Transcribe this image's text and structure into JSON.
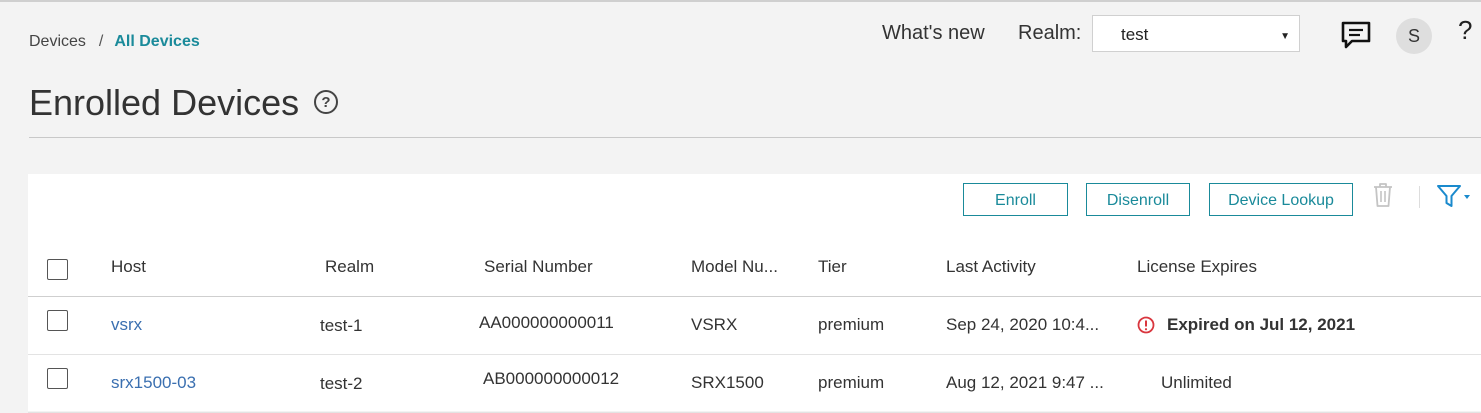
{
  "breadcrumb": {
    "parent": "Devices",
    "separator": "/",
    "current": "All Devices"
  },
  "header": {
    "whats_new": "What's new",
    "realm_label": "Realm:",
    "realm_value": "test",
    "avatar_initial": "S",
    "help": "?"
  },
  "page": {
    "title": "Enrolled Devices",
    "help_glyph": "?"
  },
  "toolbar": {
    "enroll": "Enroll",
    "disenroll": "Disenroll",
    "device_lookup": "Device Lookup"
  },
  "table": {
    "columns": {
      "host": "Host",
      "realm": "Realm",
      "serial": "Serial Number",
      "model": "Model Nu...",
      "tier": "Tier",
      "last_activity": "Last Activity",
      "license": "License Expires"
    },
    "rows": [
      {
        "host": "vsrx",
        "realm": "test-1",
        "serial": "AA000000000011",
        "model": "VSRX",
        "tier": "premium",
        "last_activity": "Sep 24, 2020 10:4...",
        "license": "Expired on Jul 12, 2021"
      },
      {
        "host": "srx1500-03",
        "realm": "test-2",
        "serial": "AB000000000012",
        "model": "SRX1500",
        "tier": "premium",
        "last_activity": "Aug 12, 2021 9:47 ...",
        "license": "Unlimited"
      }
    ]
  },
  "colors": {
    "accent": "#1a8a9a",
    "link": "#3a6fb0",
    "error": "#d9363e",
    "filter": "#1a8acd"
  }
}
